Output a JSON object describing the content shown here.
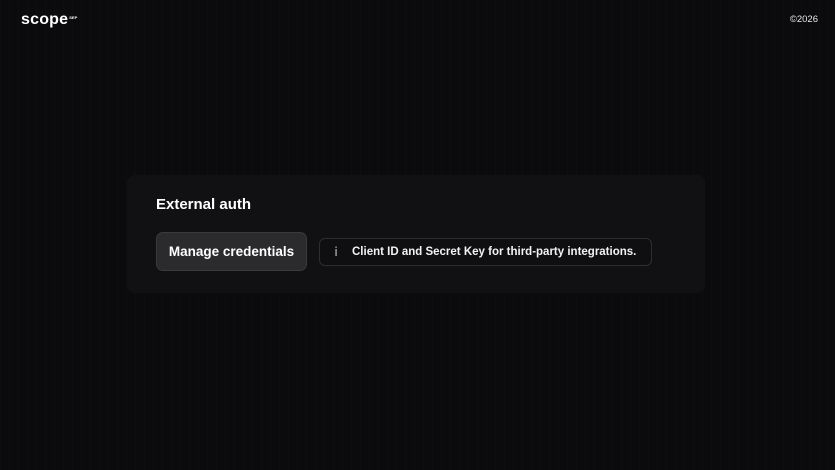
{
  "header": {
    "logo_text": "scope",
    "logo_superscript": "SEP",
    "copyright": "©2026"
  },
  "card": {
    "title": "External auth",
    "manage_button_label": "Manage credentials",
    "info_icon": "info-icon",
    "info_text": "Client ID and Secret Key for third-party integrations."
  },
  "colors": {
    "background": "#0b0b0d",
    "card_background": "#111113",
    "button_background": "#2b2b2e",
    "text": "#ffffff"
  }
}
